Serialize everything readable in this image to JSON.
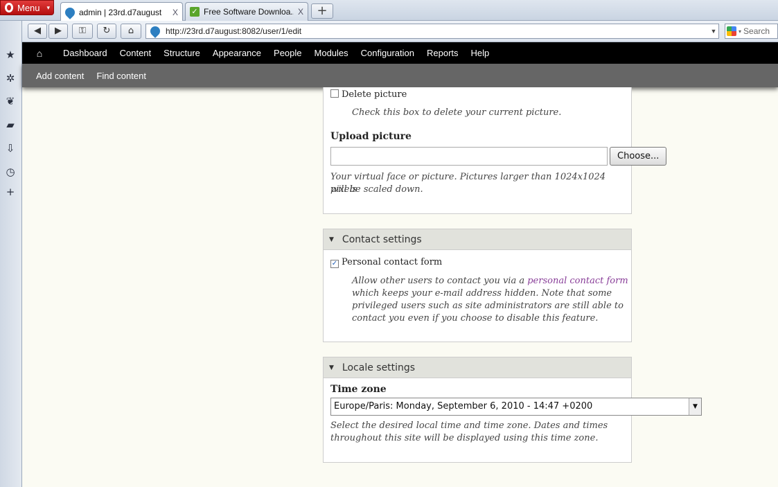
{
  "browser": {
    "menu_label": "Menu",
    "tabs": [
      {
        "title": "admin | 23rd.d7august",
        "close": "X"
      },
      {
        "title": "Free Software Downloa...",
        "close": "X"
      }
    ],
    "new_tab": "+",
    "address": "http://23rd.d7august:8082/user/1/edit",
    "search_placeholder": "Search"
  },
  "toolbar": {
    "items": [
      "Dashboard",
      "Content",
      "Structure",
      "Appearance",
      "People",
      "Modules",
      "Configuration",
      "Reports",
      "Help"
    ]
  },
  "shortcuts": [
    "Add content",
    "Find content"
  ],
  "picture": {
    "delete_label": "Delete picture",
    "delete_desc": "Check this box to delete your current picture.",
    "upload_label": "Upload picture",
    "choose_button": "Choose...",
    "upload_desc_1": "Your virtual face or picture. Pictures larger than 1024x1024 pixels",
    "upload_desc_2": "will be scaled down."
  },
  "contact": {
    "title": "Contact settings",
    "checkbox_label": "Personal contact form",
    "desc_pre": "Allow other users to contact you via a ",
    "desc_link": "personal contact form",
    "desc_l2": "which keeps your e-mail address hidden. Note that some",
    "desc_l3": "privileged users such as site administrators are still able to",
    "desc_l4": "contact you even if you choose to disable this feature."
  },
  "locale": {
    "title": "Locale settings",
    "timezone_label": "Time zone",
    "timezone_value": "Europe/Paris: Monday, September 6, 2010 - 14:47 +0200",
    "desc_1": "Select the desired local time and time zone. Dates and times",
    "desc_2": "throughout this site will be displayed using this time zone."
  }
}
